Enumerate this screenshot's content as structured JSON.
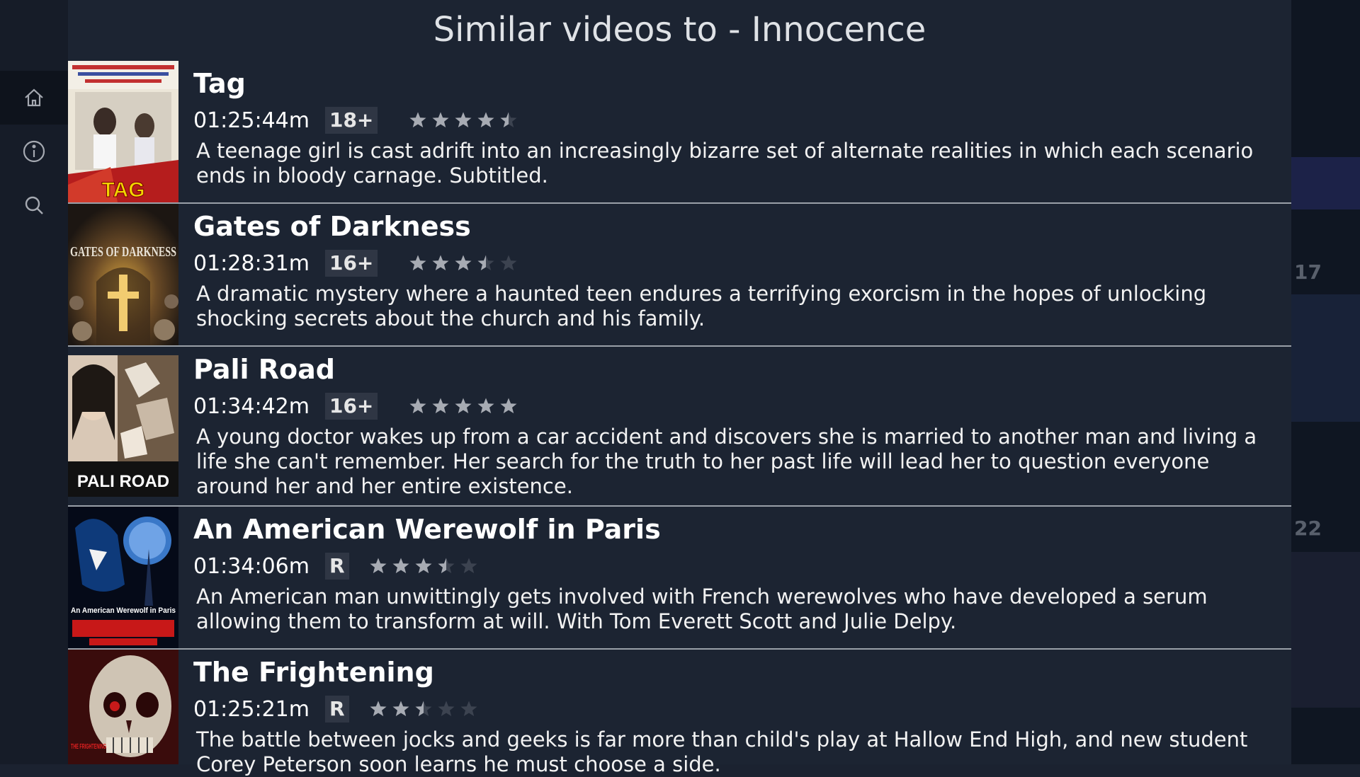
{
  "page": {
    "title": "Similar videos to - Innocence"
  },
  "sidebar": {
    "items": [
      {
        "icon": "home-icon",
        "active": true
      },
      {
        "icon": "info-icon",
        "active": false
      },
      {
        "icon": "search-icon",
        "active": false
      }
    ]
  },
  "background": {
    "numbers": [
      "17",
      "22"
    ]
  },
  "videos": [
    {
      "title": "Tag",
      "duration": "01:25:44m",
      "rating": "18+",
      "stars": 4.5,
      "description": "A teenage girl is cast adrift into an increasingly bizarre set of alternate realities in which each scenario ends in bloody carnage. Subtitled.",
      "poster_text": "TAG"
    },
    {
      "title": "Gates of Darkness",
      "duration": "01:28:31m",
      "rating": "16+",
      "stars": 3.5,
      "description": "A dramatic mystery where a haunted teen endures a terrifying exorcism in the hopes of unlocking shocking secrets about the church and his family.",
      "poster_text": "GATES OF DARKNESS"
    },
    {
      "title": "Pali Road",
      "duration": "01:34:42m",
      "rating": "16+",
      "stars": 5,
      "description": "A young doctor wakes up from a car accident and discovers she is married to another man and living a life she can't remember. Her search for the truth to her past life will lead her to question everyone around her and her entire existence.",
      "poster_text": "PALI ROAD"
    },
    {
      "title": "An American Werewolf in Paris",
      "duration": "01:34:06m",
      "rating": "R",
      "stars": 3.5,
      "description": "An American man unwittingly gets involved with French werewolves who have developed a serum allowing them to transform at will. With Tom Everett Scott and Julie Delpy.",
      "poster_text": "An American Werewolf in Paris"
    },
    {
      "title": "The Frightening",
      "duration": "01:25:21m",
      "rating": "R",
      "stars": 2.5,
      "description": "The battle between jocks and geeks is far more than child's play at Hallow End High, and new student Corey Peterson soon learns he must choose a side.",
      "poster_text": "THE FRIGHTENING"
    }
  ],
  "colors": {
    "panel": "#1c2432",
    "sidebar": "#161c28",
    "separator": "#9aa0a8",
    "star_on": "#a7abb3",
    "star_off": "#3c4350",
    "rating_bg": "#2f3644"
  }
}
